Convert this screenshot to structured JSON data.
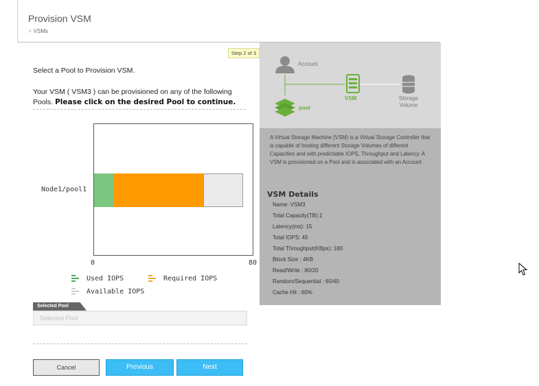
{
  "header": {
    "title": "Provision VSM",
    "breadcrumb": "VSMs"
  },
  "step": "Step 2 of 3",
  "intro": {
    "line1": "Select a Pool to Provision VSM.",
    "line2_plain": "Your VSM ( VSM3 ) can be provisioned on any of the following Pools. ",
    "line2_bold": "Please click on the desired Pool to continue."
  },
  "chart_data": {
    "type": "bar",
    "orientation": "horizontal",
    "stacked": true,
    "categories": [
      "Node1/pool1"
    ],
    "series": [
      {
        "name": "Used IOPS",
        "values": [
          10
        ],
        "color": "#7cc77f"
      },
      {
        "name": "Required IOPS",
        "values": [
          45
        ],
        "color": "#ff9900"
      },
      {
        "name": "Available IOPS",
        "values": [
          20
        ],
        "color": "#ebebeb"
      }
    ],
    "xlim": [
      0,
      80
    ],
    "tick_labels": [
      "0",
      "80"
    ],
    "legend": [
      "Used IOPS",
      "Required IOPS",
      "Available IOPS"
    ]
  },
  "selected_pool": {
    "tab_label": "Selected Pool",
    "placeholder": "Selected Pool"
  },
  "buttons": {
    "cancel": "Cancel",
    "previous": "Previous",
    "next": "Next"
  },
  "diagram": {
    "account": "Account",
    "pool": "pool",
    "vsm": "VSM",
    "storage": "Storage Volume",
    "accent": "#6ab03a"
  },
  "description": "A Virtual Storage Machine (VSM) is a Virtual Storage Controller that is capable of hosting different Storage Volumes of different Capacities and with predictable IOPS, Throughput and Latency. A VSM is provisioned on a Pool and is associated with an Account",
  "details": {
    "title": "VSM Details",
    "lines": [
      "Name: VSM3",
      "Total Capacity(TB):1",
      "Latency(ms): 15",
      "Total IOPS: 45",
      "Total Throughput(KBps): 180",
      "Block Size : 4KB",
      "Read/Write : 80/20",
      "Random/Sequential : 60/40",
      "Cache Hit : 60%"
    ]
  }
}
